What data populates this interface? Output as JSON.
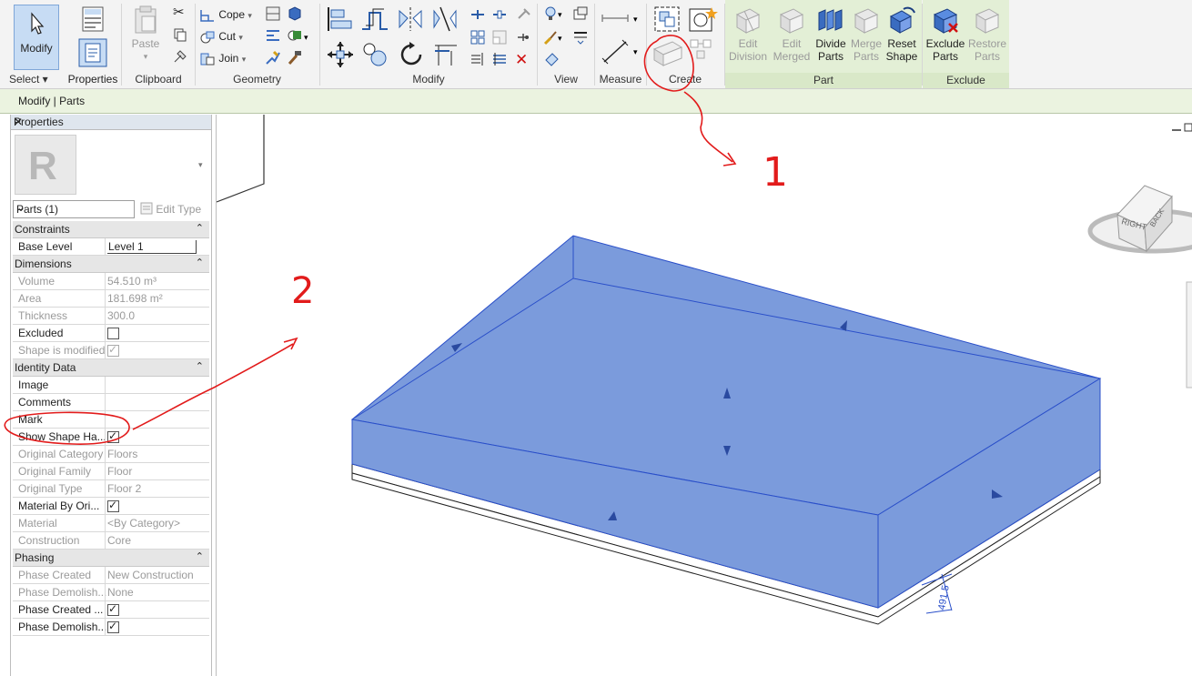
{
  "ribbon": {
    "select": {
      "modify_label": "Modify",
      "panel_label": "Select ▾"
    },
    "properties": {
      "button_label": "Properties"
    },
    "clipboard": {
      "paste_label": "Paste",
      "panel_label": "Clipboard"
    },
    "geometry": {
      "cope_label": "Cope",
      "cut_label": "Cut",
      "join_label": "Join",
      "panel_label": "Geometry"
    },
    "modify": {
      "panel_label": "Modify"
    },
    "view": {
      "panel_label": "View"
    },
    "measure": {
      "panel_label": "Measure"
    },
    "create": {
      "panel_label": "Create"
    },
    "part": {
      "edit_division_1": "Edit",
      "edit_division_2": "Division",
      "edit_merged_1": "Edit",
      "edit_merged_2": "Merged",
      "divide_parts_1": "Divide",
      "divide_parts_2": "Parts",
      "merge_parts_1": "Merge",
      "merge_parts_2": "Parts",
      "reset_shape_1": "Reset",
      "reset_shape_2": "Shape",
      "panel_label": "Part"
    },
    "exclude": {
      "exclude_parts_1": "Exclude",
      "exclude_parts_2": "Parts",
      "restore_parts_1": "Restore",
      "restore_parts_2": "Parts",
      "panel_label": "Exclude"
    }
  },
  "context_bar": {
    "label": "Modify | Parts"
  },
  "properties": {
    "title": "Properties",
    "close": "✕",
    "type_selector": "Parts (1)",
    "edit_type": "Edit Type",
    "sections": [
      {
        "name": "Constraints",
        "rows": [
          {
            "key": "Base Level",
            "value": "Level 1"
          }
        ]
      },
      {
        "name": "Dimensions",
        "rows": [
          {
            "key": "Volume",
            "value": "54.510 m³"
          },
          {
            "key": "Area",
            "value": "181.698 m²"
          },
          {
            "key": "Thickness",
            "value": "300.0"
          },
          {
            "key": "Excluded",
            "value": ""
          },
          {
            "key": "Shape is modified",
            "value": ""
          }
        ]
      },
      {
        "name": "Identity Data",
        "rows": [
          {
            "key": "Image",
            "value": ""
          },
          {
            "key": "Comments",
            "value": ""
          },
          {
            "key": "Mark",
            "value": ""
          },
          {
            "key": "Show Shape Ha...",
            "value": ""
          },
          {
            "key": "Original Category",
            "value": "Floors"
          },
          {
            "key": "Original Family",
            "value": "Floor"
          },
          {
            "key": "Original Type",
            "value": "Floor 2"
          },
          {
            "key": "Material By Ori...",
            "value": ""
          },
          {
            "key": "Material",
            "value": "<By Category>"
          },
          {
            "key": "Construction",
            "value": "Core"
          }
        ]
      },
      {
        "name": "Phasing",
        "rows": [
          {
            "key": "Phase Created",
            "value": "New Construction"
          },
          {
            "key": "Phase Demolish...",
            "value": "None"
          },
          {
            "key": "Phase Created ...",
            "value": ""
          },
          {
            "key": "Phase Demolish...",
            "value": ""
          }
        ]
      }
    ]
  },
  "viewport": {
    "viewcube_front": "RIGHT",
    "viewcube_side": "BACK",
    "dimension_value": "491.5",
    "annotation_1": "1",
    "annotation_2": "2"
  },
  "colors": {
    "part_fill": "#7b9bdc",
    "part_edge": "#2a4fc9",
    "annotation": "#e21b1b",
    "ribbon_green": "#e3efd6"
  }
}
